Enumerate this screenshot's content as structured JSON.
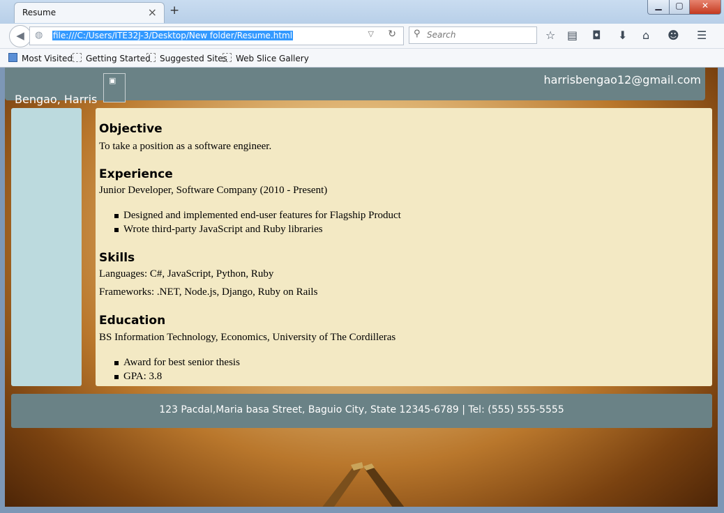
{
  "browser": {
    "tab_title": "Resume",
    "tab_close": "×",
    "new_tab": "+",
    "url": "file:///C:/Users/ITE32J-3/Desktop/New folder/Resume.html",
    "search_placeholder": "Search",
    "bookmarks": [
      "Most Visited",
      "Getting Started",
      "Suggested Sites",
      "Web Slice Gallery"
    ],
    "toolbar_icons": [
      "star-icon",
      "reading-list-icon",
      "pocket-icon",
      "download-icon",
      "home-icon",
      "hello-icon",
      "menu-icon"
    ]
  },
  "header": {
    "name": "Bengao, Harris",
    "email": "harrisbengao12@gmail.com"
  },
  "objective": {
    "heading": "Objective",
    "text": "To take a position as a software engineer."
  },
  "experience": {
    "heading": "Experience",
    "job": "Junior Developer, Software Company (2010 - Present)",
    "bullets": [
      "Designed and implemented end-user features for Flagship Product",
      "Wrote third-party JavaScript and Ruby libraries"
    ]
  },
  "skills": {
    "heading": "Skills",
    "languages": "Languages: C#, JavaScript, Python, Ruby",
    "frameworks": "Frameworks: .NET, Node.js, Django, Ruby on Rails"
  },
  "education": {
    "heading": "Education",
    "degree": "BS Information Technology, Economics, University of The Cordilleras",
    "bullets": [
      "Award for best senior thesis",
      "GPA: 3.8"
    ]
  },
  "footer": {
    "text": "123 Pacdal,Maria basa Street, Baguio City, State 12345-6789 | Tel: (555) 555-5555"
  },
  "colors": {
    "header_bg": "#6a8286",
    "sidebar_bg": "#bcdade",
    "main_bg": "#f3e9c4"
  }
}
